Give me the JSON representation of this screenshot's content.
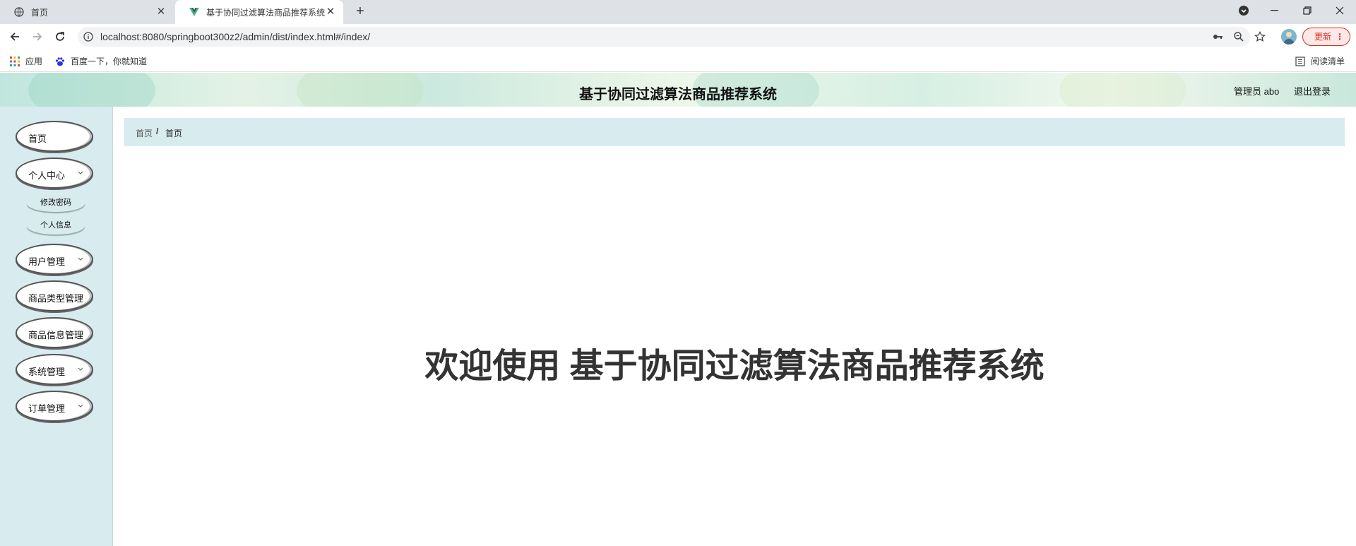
{
  "browser": {
    "tabs": [
      {
        "title": "首页",
        "active": false
      },
      {
        "title": "基于协同过滤算法商品推荐系统",
        "active": true
      }
    ],
    "url": "localhost:8080/springboot300z2/admin/dist/index.html#/index/",
    "update_label": "更新",
    "bookmarks": {
      "apps_label": "应用",
      "baidu_label": "百度一下，你就知道",
      "reading_list_label": "阅读清单"
    }
  },
  "header": {
    "title": "基于协同过滤算法商品推荐系统",
    "user_label": "管理员 abo",
    "logout_label": "退出登录"
  },
  "sidebar": {
    "items": [
      {
        "label": "首页",
        "has_submenu": false
      },
      {
        "label": "个人中心",
        "has_submenu": true
      },
      {
        "label": "用户管理",
        "has_submenu": true
      },
      {
        "label": "商品类型管理",
        "has_submenu": false
      },
      {
        "label": "商品信息管理",
        "has_submenu": false
      },
      {
        "label": "系统管理",
        "has_submenu": true
      },
      {
        "label": "订单管理",
        "has_submenu": true
      }
    ],
    "subitems": [
      {
        "label": "修改密码"
      },
      {
        "label": "个人信息"
      }
    ]
  },
  "breadcrumb": {
    "root": "首页",
    "separator": "/",
    "current": "首页"
  },
  "main": {
    "welcome_text": "欢迎使用 基于协同过滤算法商品推荐系统"
  },
  "colors": {
    "sidebar_bg": "#d8ebee",
    "update_accent": "#d93025"
  }
}
